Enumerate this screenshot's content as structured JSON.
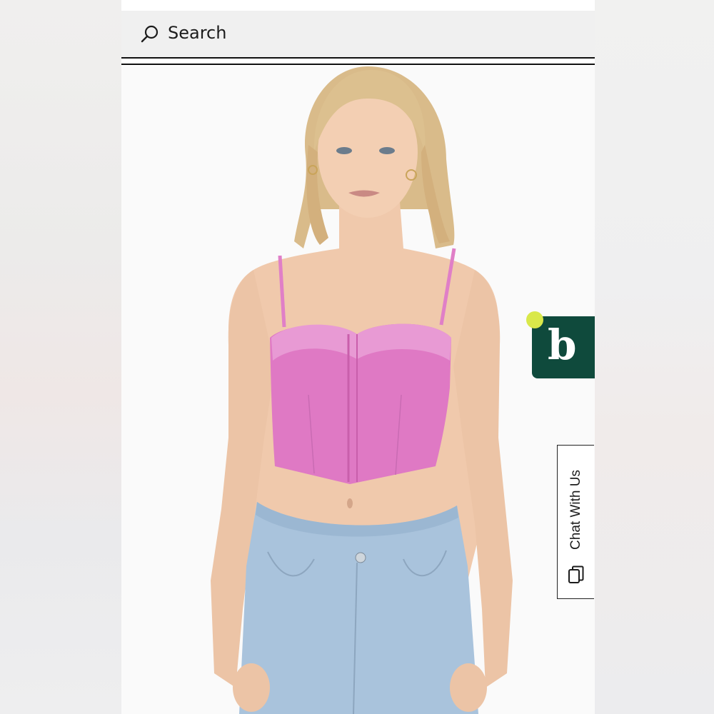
{
  "search": {
    "placeholder": "Search",
    "icon": "search-icon"
  },
  "badge": {
    "letter": "b",
    "color": "#0f4a3c",
    "dot_color": "#d9e84a"
  },
  "chat": {
    "label": "Chat With Us",
    "icon": "chat-copy-icon"
  },
  "product_image": {
    "subject": "model-in-pink-corset-top"
  }
}
